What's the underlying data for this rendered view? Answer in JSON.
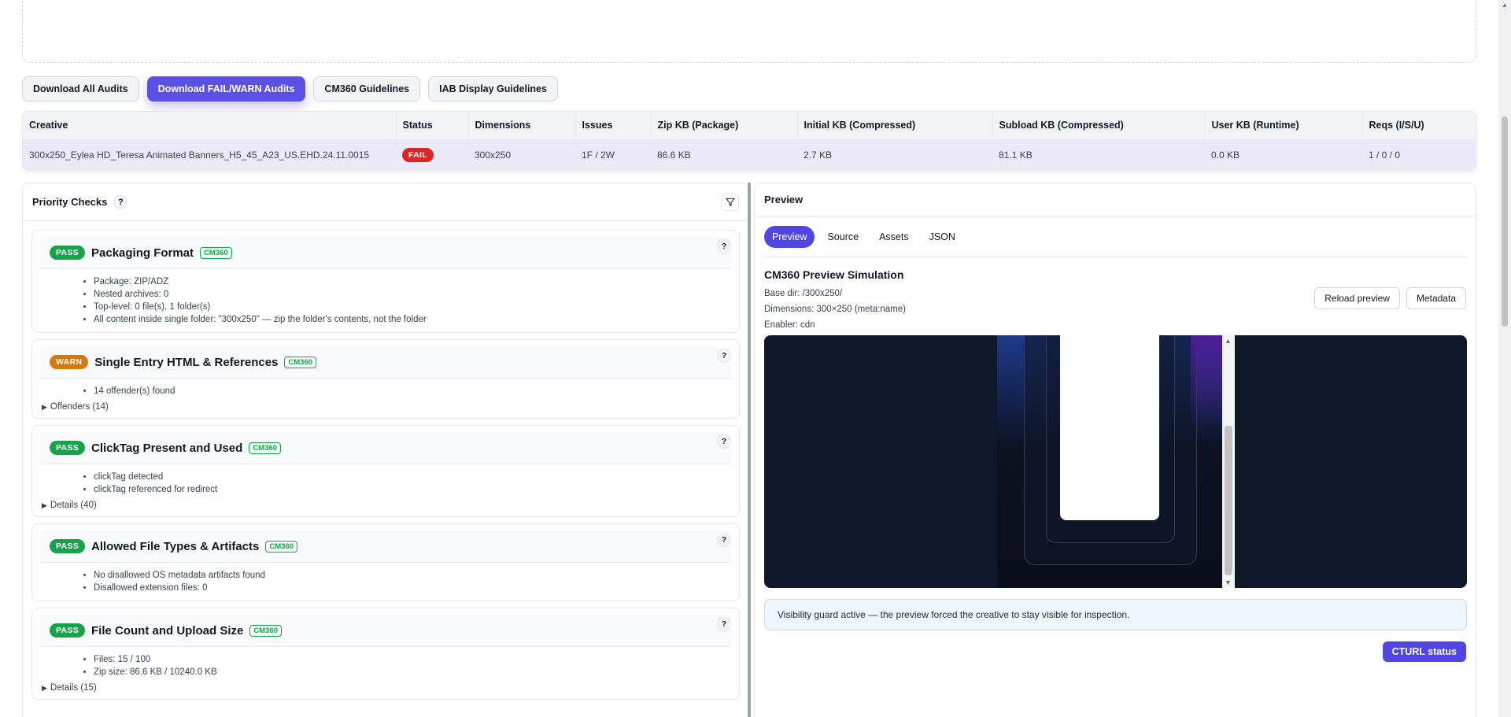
{
  "actions": {
    "download_all": "Download All Audits",
    "download_fail_warn": "Download FAIL/WARN Audits",
    "cm360_guidelines": "CM360 Guidelines",
    "iab_guidelines": "IAB Display Guidelines"
  },
  "summary": {
    "headers": [
      "Creative",
      "Status",
      "Dimensions",
      "Issues",
      "Zip KB (Package)",
      "Initial KB (Compressed)",
      "Subload KB (Compressed)",
      "User KB (Runtime)",
      "Reqs (I/S/U)"
    ],
    "row": {
      "creative": "300x250_Eylea HD_Teresa Animated Banners_H5_45_A23_US.EHD.24.11.0015",
      "status": "FAIL",
      "dimensions": "300x250",
      "issues": "1F / 2W",
      "zip_kb": "86.6 KB",
      "initial_kb": "2.7 KB",
      "subload_kb": "81.1 KB",
      "user_kb": "0.0 KB",
      "reqs": "1 / 0 / 0"
    }
  },
  "priority": {
    "title": "Priority Checks",
    "help": "?",
    "checks": [
      {
        "status": "PASS",
        "title": "Packaging Format",
        "tag": "CM360",
        "items": [
          "Package: ZIP/ADZ",
          "Nested archives: 0",
          "Top-level: 0 file(s), 1 folder(s)",
          "All content inside single folder: \"300x250\" — zip the folder's contents, not the folder"
        ]
      },
      {
        "status": "WARN",
        "title": "Single Entry HTML & References",
        "tag": "CM360",
        "items": [
          "14 offender(s) found"
        ],
        "details": "Offenders (14)"
      },
      {
        "status": "PASS",
        "title": "ClickTag Present and Used",
        "tag": "CM360",
        "items": [
          "clickTag detected",
          "clickTag referenced for redirect"
        ],
        "details": "Details (40)"
      },
      {
        "status": "PASS",
        "title": "Allowed File Types & Artifacts",
        "tag": "CM360",
        "items": [
          "No disallowed OS metadata artifacts found",
          "Disallowed extension files: 0"
        ]
      },
      {
        "status": "PASS",
        "title": "File Count and Upload Size",
        "tag": "CM360",
        "items": [
          "Files: 15 / 100",
          "Zip size: 86.6 KB / 10240.0 KB"
        ],
        "details": "Details (15)"
      }
    ]
  },
  "preview": {
    "title": "Preview",
    "tabs": [
      "Preview",
      "Source",
      "Assets",
      "JSON"
    ],
    "sim_title": "CM360 Preview Simulation",
    "base_dir": "Base dir: /300x250/",
    "dimensions": "Dimensions: 300×250 (meta:name)",
    "enabler": "Enabler: cdn",
    "reload": "Reload preview",
    "metadata": "Metadata",
    "notice": "Visibility guard active — the preview forced the creative to stay visible for inspection.",
    "cturl": "CTURL status"
  },
  "colors": {
    "accent": "#4f46e5",
    "fail": "#dc2626",
    "pass": "#16a34a",
    "warn": "#d97706"
  }
}
